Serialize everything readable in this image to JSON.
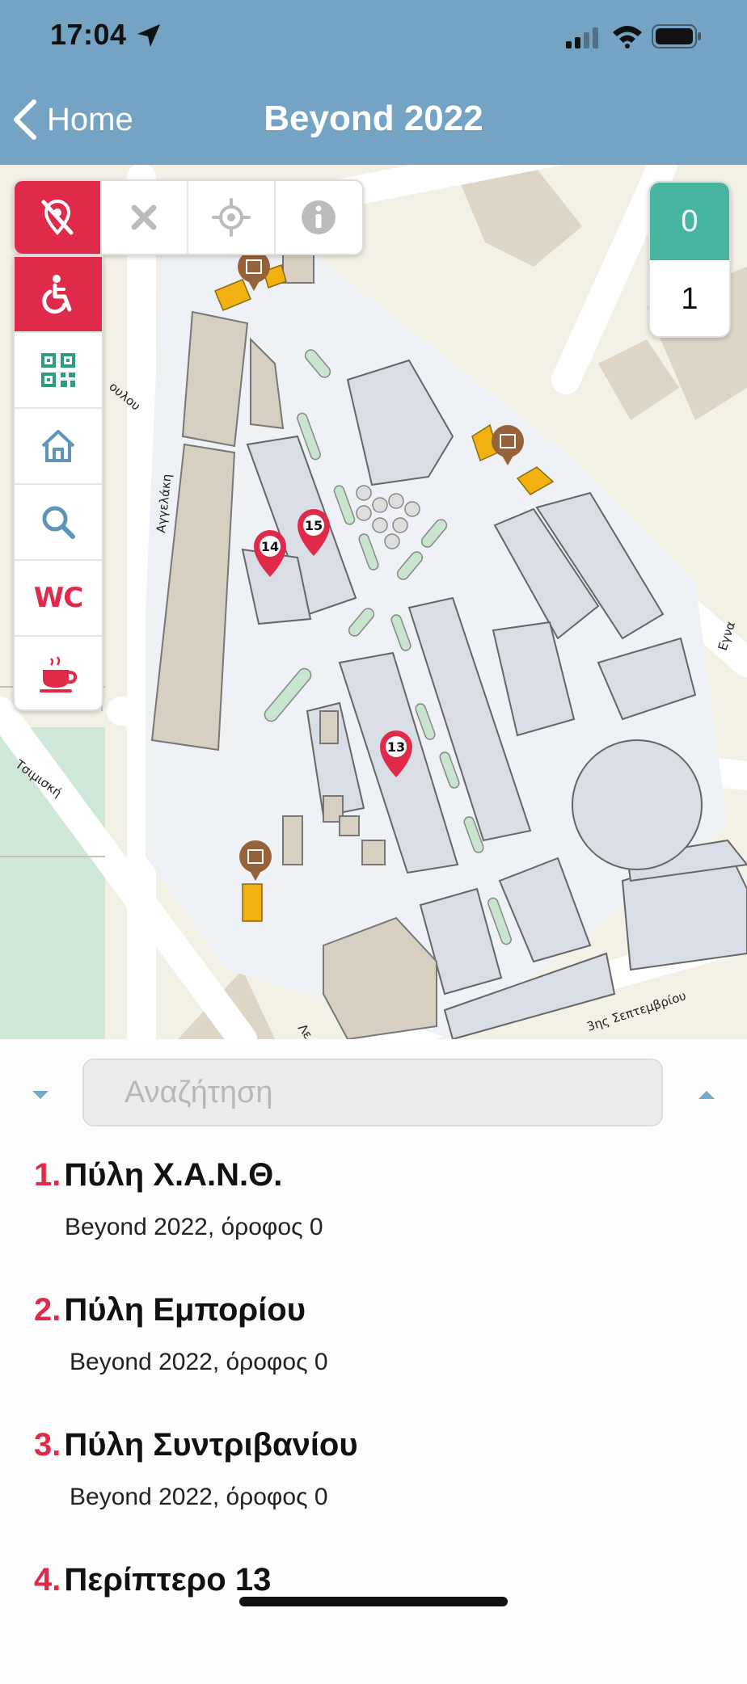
{
  "status_bar": {
    "time": "17:04"
  },
  "nav": {
    "back_label": "Home",
    "title": "Beyond 2022"
  },
  "map": {
    "toolbar": [
      {
        "name": "no-location-icon",
        "active": true
      },
      {
        "name": "close-icon",
        "active": false
      },
      {
        "name": "crosshair-icon",
        "active": false
      },
      {
        "name": "info-icon",
        "active": false
      }
    ],
    "sidebar": [
      {
        "name": "accessibility-icon",
        "active": true
      },
      {
        "name": "qr-code-icon",
        "active": false
      },
      {
        "name": "home-icon",
        "active": false
      },
      {
        "name": "search-icon",
        "active": false
      },
      {
        "name": "wc-icon",
        "label": "WC",
        "active": false
      },
      {
        "name": "coffee-icon",
        "active": false
      }
    ],
    "floors": [
      "0",
      "1"
    ],
    "active_floor": "0",
    "pins": [
      "13",
      "14",
      "15"
    ],
    "streets": [
      "Αγγελάκη",
      "Τσιμισκή",
      "3ης Σεπτεμβρίου",
      "Εγνα",
      "Λε",
      "ουλου"
    ]
  },
  "search": {
    "placeholder": "Αναζήτηση"
  },
  "results": [
    {
      "number": "1.",
      "title": "Πύλη Χ.Α.Ν.Θ.",
      "subtitle": "Beyond 2022, όροφος 0"
    },
    {
      "number": "2.",
      "title": "Πύλη Εμπορίου",
      "subtitle": "Beyond 2022, όροφος 0"
    },
    {
      "number": "3.",
      "title": "Πύλη Συντριβανίου",
      "subtitle": "Beyond 2022, όροφος 0"
    },
    {
      "number": "4.",
      "title": "Περίπτερο 13",
      "subtitle": ""
    }
  ],
  "colors": {
    "header": "#74a3c3",
    "accent": "#e02a4a",
    "floor_active": "#47b5a0",
    "building": "#d9dde6",
    "poi": "#96623a"
  }
}
